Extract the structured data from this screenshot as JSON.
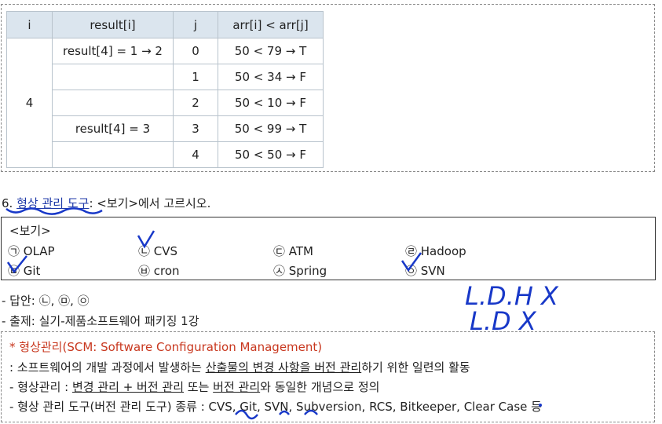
{
  "table": {
    "headers": [
      "i",
      "result[i]",
      "j",
      "arr[i] < arr[j]"
    ],
    "i_value": "4",
    "rows": [
      {
        "result": "result[4] = 1 → 2",
        "j": "0",
        "cmp": "50 < 79 → T"
      },
      {
        "result": "",
        "j": "1",
        "cmp": "50 < 34 → F"
      },
      {
        "result": "",
        "j": "2",
        "cmp": "50 < 10 → F"
      },
      {
        "result": "result[4] = 3",
        "j": "3",
        "cmp": "50 < 99 → T"
      },
      {
        "result": "",
        "j": "4",
        "cmp": "50 < 50 → F"
      }
    ]
  },
  "question": {
    "number": "6.",
    "highlight": "형상 관리 도구",
    "rest": ": <보기>에서 고르시오."
  },
  "example": {
    "title": "<보기>",
    "options": [
      "㉠ OLAP",
      "㉡ CVS",
      "㉢ ATM",
      "㉣ Hadoop",
      "㉤ Git",
      "㉥ cron",
      "㉦ Spring",
      "㉧ SVN"
    ]
  },
  "answer_line": "- 답안: ㉡, ㉤, ㉧",
  "source_line": "- 출제: 실기-제품소프트웨어 패키징 1강",
  "notes": {
    "title": "* 형상관리(SCM: Software Configuration Management)",
    "line1_a": ": 소프트웨어의 개발 과정에서 발생하는 ",
    "line1_b": "산출물의 변경 사항을 버전 관리",
    "line1_c": "하기 위한 일련의 활동",
    "line2_a": "- 형상관리 : ",
    "line2_b": "변경 관리 + 버전 관리",
    "line2_c": " 또는 ",
    "line2_d": "버전 관리",
    "line2_e": "와 동일한 개념으로 정의",
    "line3": "- 형상 관리 도구(버전 관리 도구) 종류 : CVS, Git, SVN, Subversion, RCS, Bitkeeper, Clear Case 등"
  },
  "handwriting": {
    "line1": "L.D.H X",
    "line2": "L.D X"
  },
  "colors": {
    "ink": "#1838c8",
    "note_red": "#c8371e",
    "table_header": "#dbe5ee"
  }
}
